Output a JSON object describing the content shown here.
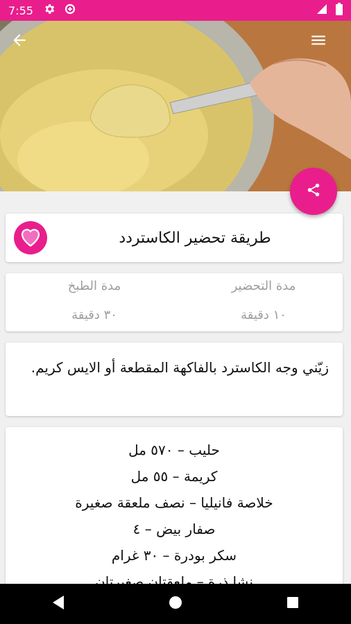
{
  "status_bar": {
    "time": "7:55",
    "background": "#e91e8c",
    "icons": [
      "settings-icon",
      "data-saver-icon",
      "signal-icon",
      "battery-icon"
    ]
  },
  "header": {
    "hero_image": "custard-bowl-spoon-photo",
    "back_icon": "arrow-back-icon",
    "menu_icon": "hamburger-menu-icon",
    "share_icon": "share-icon"
  },
  "recipe": {
    "title": "طريقة تحضير الكاستردد",
    "favorite_icon": "heart-icon",
    "prep_label": "مدة التحضير",
    "prep_value": "١٠ دقيقة",
    "cook_label": "مدة الطبخ",
    "cook_value": "٣٠ دقيقة",
    "description": "زيّني وجه الكاسترد بالفاكهة المقطعة أو الايس كريم.",
    "ingredients": [
      "حليب – ٥٧٠ مل",
      "كريمة – ٥٥ مل",
      "خلاصة فانيليا – نصف ملعقة صغيرة",
      "صفار بيض – ٤",
      "سكر بودرة – ٣٠ غرام",
      "نشا ذرة – ملعقتان صغيرتان"
    ]
  },
  "nav": {
    "back_icon": "nav-back-icon",
    "home_icon": "nav-home-icon",
    "recents_icon": "nav-recents-icon"
  },
  "colors": {
    "accent": "#e91e8c",
    "favorite": "#f06fc0"
  }
}
